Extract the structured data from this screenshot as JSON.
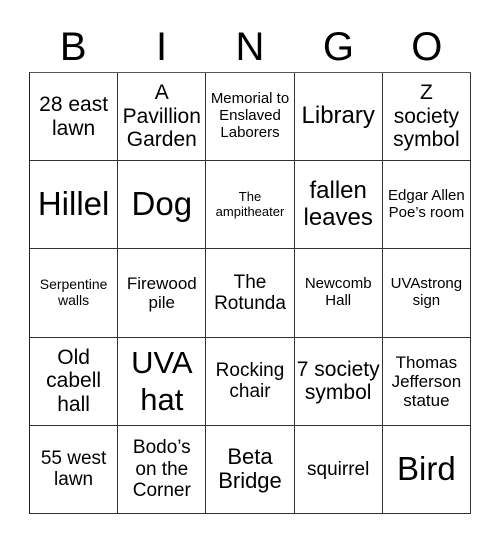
{
  "header": {
    "letters": [
      "B",
      "I",
      "N",
      "G",
      "O"
    ]
  },
  "board": {
    "rows": [
      [
        "28 east lawn",
        "A Pavillion Garden",
        "Memorial to Enslaved Laborers",
        "Library",
        "Z society symbol"
      ],
      [
        "Hillel",
        "Dog",
        "The ampitheater",
        "fallen leaves",
        "Edgar Allen Poe’s room"
      ],
      [
        "Serpentine walls",
        "Firewood pile",
        "The Rotunda",
        "Newcomb Hall",
        "UVAstrong sign"
      ],
      [
        "Old cabell hall",
        "UVA hat",
        "Rocking chair",
        "7 society symbol",
        "Thomas Jefferson statue"
      ],
      [
        "55 west lawn",
        "Bodo’s on the Corner",
        "Beta Bridge",
        "squirrel",
        "Bird"
      ]
    ]
  }
}
